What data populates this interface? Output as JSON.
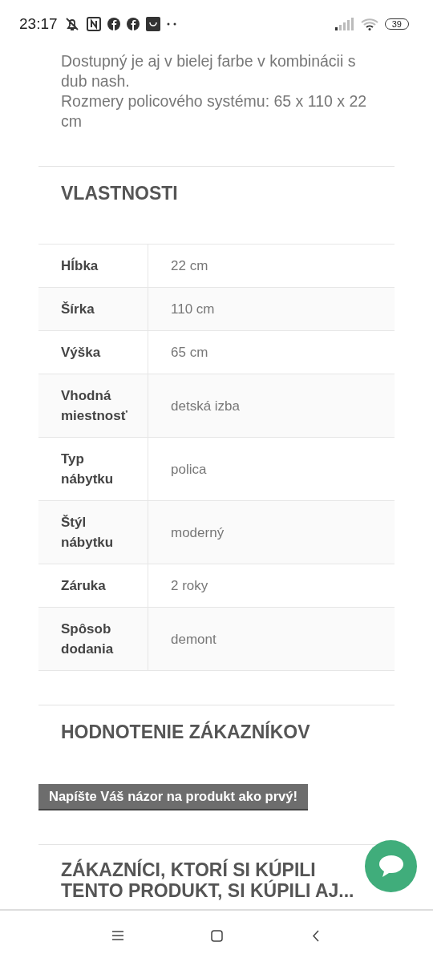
{
  "status_bar": {
    "time": "23:17",
    "battery": "39"
  },
  "description": [
    "Dostupný je aj v bielej farbe v kombinácii s dub nash.",
    "Rozmery policového systému: 65 x 110 x 22 cm"
  ],
  "properties": {
    "title": "VLASTNOSTI",
    "rows": [
      {
        "label": "Hĺbka",
        "value": "22 cm"
      },
      {
        "label": "Šírka",
        "value": "110 cm"
      },
      {
        "label": "Výška",
        "value": "65 cm"
      },
      {
        "label": "Vhodná miestnosť",
        "value": "detská izba"
      },
      {
        "label": "Typ nábytku",
        "value": "polica"
      },
      {
        "label": "Štýl nábytku",
        "value": "moderný"
      },
      {
        "label": "Záruka",
        "value": "2 roky"
      },
      {
        "label": "Spôsob dodania",
        "value": "demont"
      }
    ]
  },
  "reviews": {
    "title": "HODNOTENIE ZÁKAZNÍKOV",
    "button": "Napíšte Váš názor na produkt ako prvý!"
  },
  "related": {
    "title": "ZÁKAZNÍCI, KTORÍ SI KÚPILI TENTO PRODUKT, SI KÚPILI AJ..."
  }
}
